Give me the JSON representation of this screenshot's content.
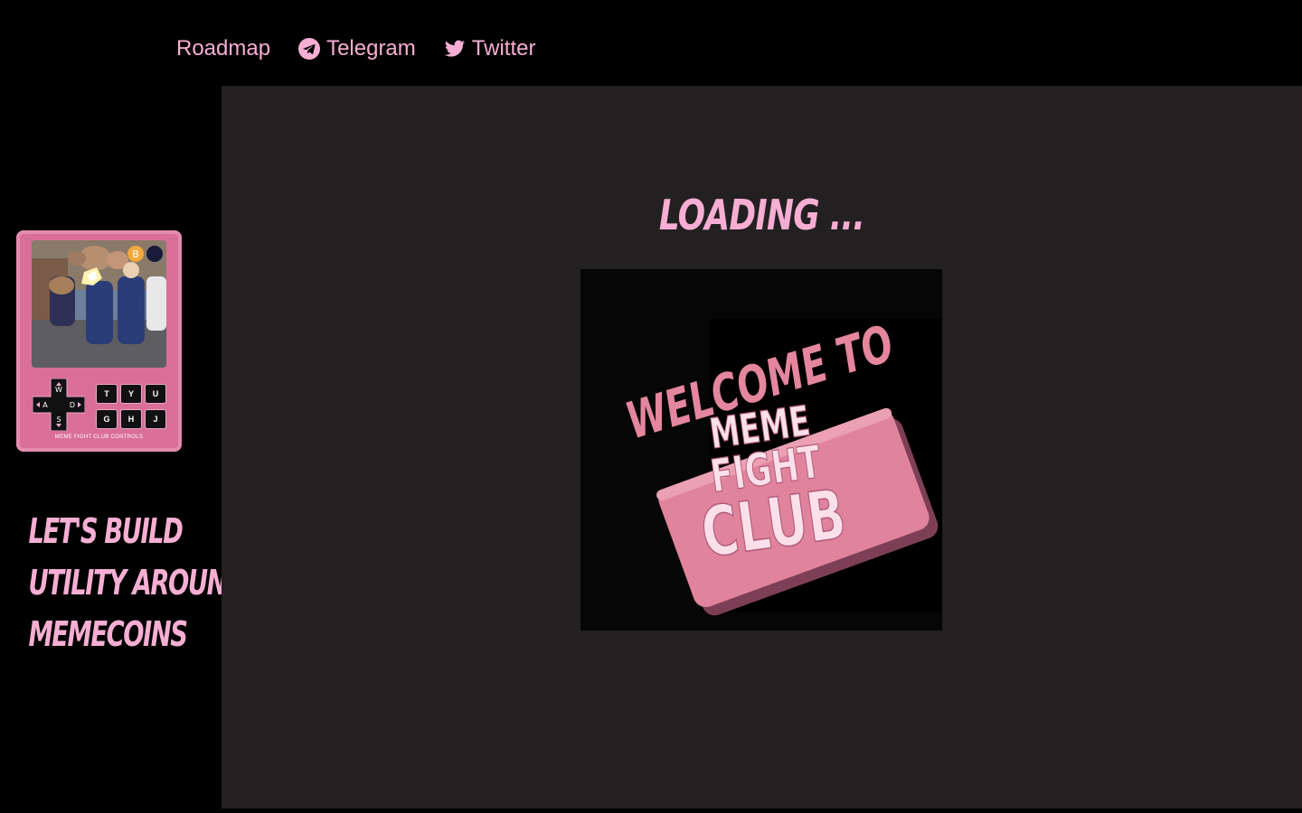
{
  "nav": {
    "items": [
      {
        "label": "Roadmap",
        "icon": ""
      },
      {
        "label": "Telegram",
        "icon": "telegram-icon"
      },
      {
        "label": "Twitter",
        "icon": "twitter-icon"
      }
    ]
  },
  "main": {
    "loading_text": "LOADING ...",
    "video": {
      "welcome_text": "WELCOME TO",
      "logo_lines": [
        "MEME",
        "FIGHT",
        "CLUB"
      ]
    }
  },
  "sidebar": {
    "controls": {
      "dpad_keys": [
        "W",
        "A",
        "S",
        "D"
      ],
      "keys": [
        "T",
        "Y",
        "U",
        "G",
        "H",
        "J"
      ],
      "caption": "MEME FIGHT CLUB CONTROLS"
    },
    "tagline": [
      "LET'S BUILD",
      "UTILITY AROUND",
      "MEMECOINS"
    ]
  },
  "colors": {
    "accent": "#f7aed3",
    "page_bg": "#000000",
    "panel_bg": "#232021",
    "device_pink": "#d96f97"
  }
}
